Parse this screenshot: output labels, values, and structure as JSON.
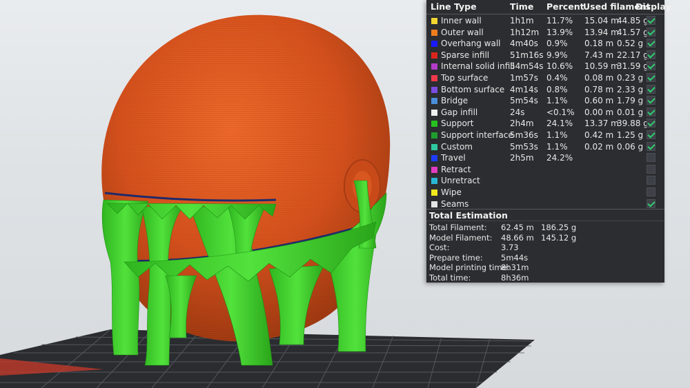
{
  "legend": {
    "headers": {
      "line_type": "Line Type",
      "time": "Time",
      "percent": "Percent",
      "used_filament": "Used filament",
      "display": "Display"
    },
    "rows": [
      {
        "name": "Inner wall",
        "color": "#f2d631",
        "time": "1h1m",
        "percent": "11.7%",
        "length": "15.04 m",
        "weight": "44.85 g",
        "display": true
      },
      {
        "name": "Outer wall",
        "color": "#f07d1e",
        "time": "1h12m",
        "percent": "13.9%",
        "length": "13.94 m",
        "weight": "41.57 g",
        "display": true
      },
      {
        "name": "Overhang wall",
        "color": "#1a1aff",
        "time": "4m40s",
        "percent": "0.9%",
        "length": "0.18 m",
        "weight": "0.52 g",
        "display": true
      },
      {
        "name": "Sparse infill",
        "color": "#d9261c",
        "time": "51m16s",
        "percent": "9.9%",
        "length": "7.43 m",
        "weight": "22.17 g",
        "display": true
      },
      {
        "name": "Internal solid infill",
        "color": "#b23cc7",
        "time": "54m54s",
        "percent": "10.6%",
        "length": "10.59 m",
        "weight": "31.59 g",
        "display": true
      },
      {
        "name": "Top surface",
        "color": "#f0394b",
        "time": "1m57s",
        "percent": "0.4%",
        "length": "0.08 m",
        "weight": "0.23 g",
        "display": true
      },
      {
        "name": "Bottom surface",
        "color": "#7a4ce0",
        "time": "4m14s",
        "percent": "0.8%",
        "length": "0.78 m",
        "weight": "2.33 g",
        "display": true
      },
      {
        "name": "Bridge",
        "color": "#4a8fd9",
        "time": "5m54s",
        "percent": "1.1%",
        "length": "0.60 m",
        "weight": "1.79 g",
        "display": true
      },
      {
        "name": "Gap infill",
        "color": "#f0f0f0",
        "time": "24s",
        "percent": "<0.1%",
        "length": "0.00 m",
        "weight": "0.01 g",
        "display": true
      },
      {
        "name": "Support",
        "color": "#26c21f",
        "time": "2h4m",
        "percent": "24.1%",
        "length": "13.37 m",
        "weight": "39.88 g",
        "display": true
      },
      {
        "name": "Support interface",
        "color": "#1f9e2f",
        "time": "5m36s",
        "percent": "1.1%",
        "length": "0.42 m",
        "weight": "1.25 g",
        "display": true
      },
      {
        "name": "Custom",
        "color": "#2ec9a1",
        "time": "5m53s",
        "percent": "1.1%",
        "length": "0.02 m",
        "weight": "0.06 g",
        "display": true
      },
      {
        "name": "Travel",
        "color": "#1e3cff",
        "time": "2h5m",
        "percent": "24.2%",
        "length": "",
        "weight": "",
        "display": false
      },
      {
        "name": "Retract",
        "color": "#e03cc0",
        "time": "",
        "percent": "",
        "length": "",
        "weight": "",
        "display": false
      },
      {
        "name": "Unretract",
        "color": "#29b6d6",
        "time": "",
        "percent": "",
        "length": "",
        "weight": "",
        "display": false
      },
      {
        "name": "Wipe",
        "color": "#f0e81e",
        "time": "",
        "percent": "",
        "length": "",
        "weight": "",
        "display": false
      },
      {
        "name": "Seams",
        "color": "#e6e6e6",
        "time": "",
        "percent": "",
        "length": "",
        "weight": "",
        "display": true
      }
    ]
  },
  "total": {
    "title": "Total Estimation",
    "rows": [
      {
        "label": "Total Filament:",
        "v1": "62.45 m",
        "v2": "186.25 g"
      },
      {
        "label": "Model Filament:",
        "v1": "48.66 m",
        "v2": "145.12 g"
      },
      {
        "label": "Cost:",
        "v1": "3.73",
        "v2": ""
      },
      {
        "label": "Prepare time:",
        "v1": "5m44s",
        "v2": ""
      },
      {
        "label": "Model printing time:",
        "v1": "8h31m",
        "v2": ""
      },
      {
        "label": "Total time:",
        "v1": "8h36m",
        "v2": ""
      }
    ]
  },
  "colors": {
    "model": "#d9531e",
    "support": "#3ccf2a",
    "panel_bg": "#2b2d30",
    "bed": "#2a2c30"
  }
}
